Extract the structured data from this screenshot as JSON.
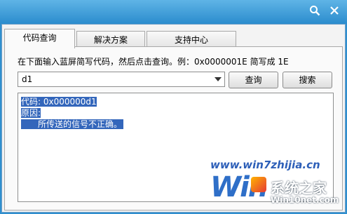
{
  "titlebar": {
    "search_icon": "search-icon",
    "close_icon": "close-icon"
  },
  "tabs": [
    {
      "label": "代码查询",
      "active": true
    },
    {
      "label": "解决方案",
      "active": false
    },
    {
      "label": "支持中心",
      "active": false
    }
  ],
  "hint": "在下面输入蓝屏简写代码，然后点击查询。例：0x0000001E 简写成 1E",
  "code_input": {
    "value": "d1"
  },
  "query_button": "查询",
  "search_button": "搜索",
  "result": {
    "code_line": "代码: 0x000000d1",
    "reason_label": "原因:",
    "reason_text": "所传送的信号不正确。"
  },
  "watermark": {
    "url": "www.win7zhijia.cn",
    "brand": "Win",
    "site_name": "系统之家",
    "site_url": "Win10net.com"
  },
  "colors": {
    "accent": "#2b8ccd",
    "selection": "#3366bb"
  }
}
